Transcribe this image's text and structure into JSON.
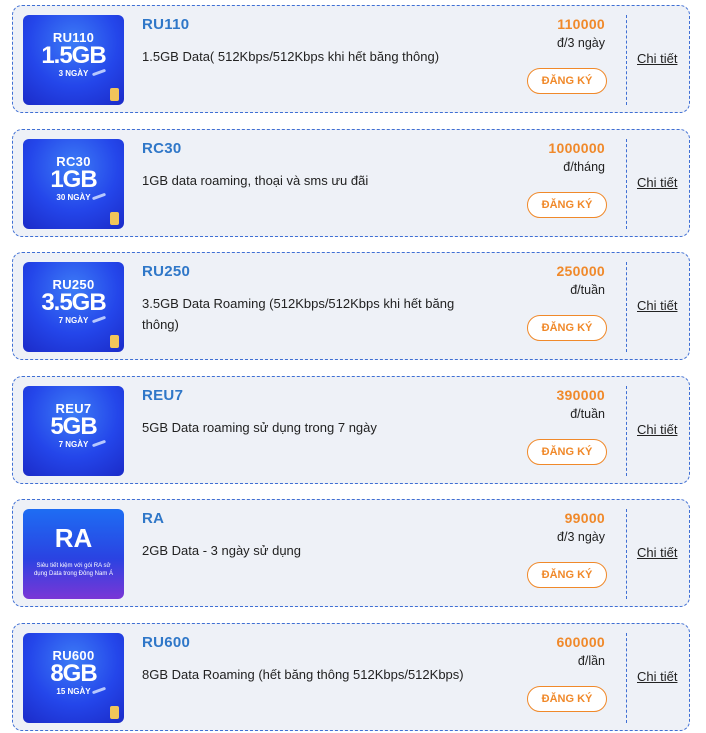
{
  "packages": [
    {
      "code": "RU110",
      "description": "1.5GB Data( 512Kbps/512Kbps khi hết băng thông)",
      "price": "110000",
      "unit": "đ/3 ngày",
      "register_label": "ĐĂNG KÝ",
      "detail_label": "Chi tiết",
      "thumb": {
        "code": "RU110",
        "size": "1.5GB",
        "days": "3 NGÀY"
      }
    },
    {
      "code": "RC30",
      "description": "1GB data roaming, thoại và sms ưu đãi",
      "price": "1000000",
      "unit": "đ/tháng",
      "register_label": "ĐĂNG KÝ",
      "detail_label": "Chi tiết",
      "thumb": {
        "code": "RC30",
        "size": "1GB",
        "days": "30 NGÀY"
      }
    },
    {
      "code": "RU250",
      "description": "3.5GB Data Roaming (512Kbps/512Kbps khi hết băng thông)",
      "price": "250000",
      "unit": "đ/tuần",
      "register_label": "ĐĂNG KÝ",
      "detail_label": "Chi tiết",
      "thumb": {
        "code": "RU250",
        "size": "3.5GB",
        "days": "7 NGÀY"
      }
    },
    {
      "code": "REU7",
      "description": "5GB Data roaming sử dụng trong 7 ngày",
      "price": "390000",
      "unit": "đ/tuần",
      "register_label": "ĐĂNG KÝ",
      "detail_label": "Chi tiết",
      "thumb": {
        "code": "REU7",
        "size": "5GB",
        "days": "7 NGÀY"
      }
    },
    {
      "code": "RA",
      "description": "2GB Data - 3 ngày sử dụng",
      "price": "99000",
      "unit": "đ/3 ngày",
      "register_label": "ĐĂNG KÝ",
      "detail_label": "Chi tiết",
      "thumb": {
        "big": "RA",
        "sub": "Siêu tiết kiệm với gói RA sử dụng Data trong Đông Nam Á"
      }
    },
    {
      "code": "RU600",
      "description": "8GB Data Roaming (hết băng thông 512Kbps/512Kbps)",
      "price": "600000",
      "unit": "đ/lần",
      "register_label": "ĐĂNG KÝ",
      "detail_label": "Chi tiết",
      "thumb": {
        "code": "RU600",
        "size": "8GB",
        "days": "15 NGÀY"
      }
    }
  ],
  "colors": {
    "accent_blue": "#2f77c8",
    "accent_orange": "#f0892a",
    "card_bg": "#eef1f7",
    "border": "#3f6fd4"
  }
}
